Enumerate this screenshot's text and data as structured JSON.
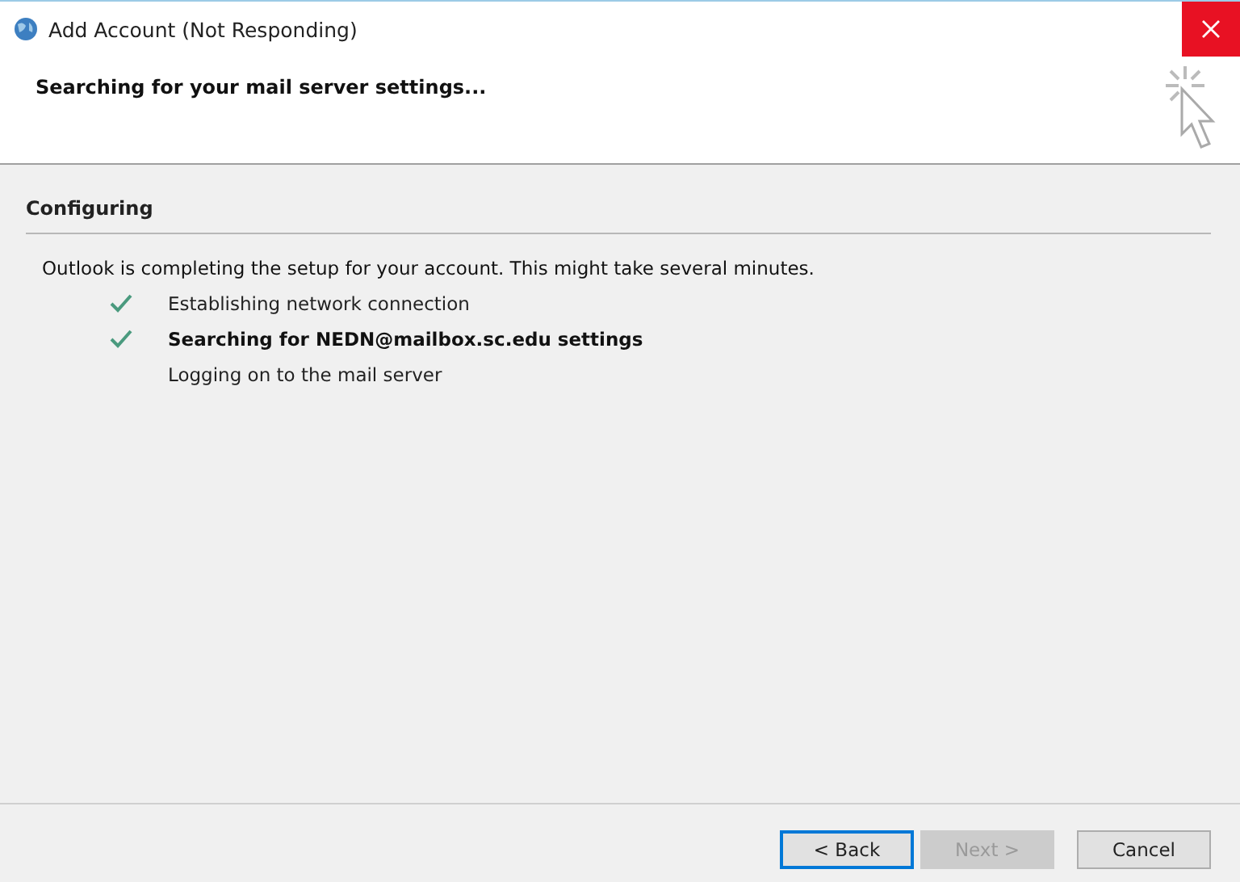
{
  "window": {
    "title": "Add Account (Not Responding)"
  },
  "header": {
    "title": "Searching for your mail server settings..."
  },
  "section": {
    "title": "Configuring"
  },
  "intro": "Outlook is completing the setup for your account. This might take several minutes.",
  "steps": [
    {
      "label": "Establishing network connection",
      "done": true,
      "active": false
    },
    {
      "label": "Searching for NEDN@mailbox.sc.edu settings",
      "done": true,
      "active": true
    },
    {
      "label": "Logging on to the mail server",
      "done": false,
      "active": false
    }
  ],
  "buttons": [
    {
      "label": "< Back",
      "disabled": false,
      "default": true
    },
    {
      "label": "Next >",
      "disabled": true,
      "default": false
    },
    {
      "label": "Cancel",
      "disabled": false,
      "default": false
    }
  ]
}
